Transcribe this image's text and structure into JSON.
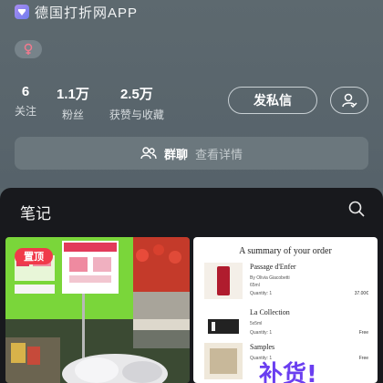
{
  "profile": {
    "ip_location": "德国打折网APP",
    "stats": [
      {
        "value": "6",
        "label": "关注"
      },
      {
        "value": "1.1万",
        "label": "粉丝"
      },
      {
        "value": "2.5万",
        "label": "获赞与收藏"
      }
    ],
    "message_button": "发私信",
    "group": {
      "label": "群聊",
      "detail": "查看详情"
    }
  },
  "notes": {
    "title": "笔记",
    "pinned_badge": "置顶",
    "order_card": {
      "heading": "A summary of your order",
      "items": [
        {
          "name": "Passage d'Enfer",
          "sub1": "By Olivia Giacobetti",
          "sub2": "65ml",
          "sub3": "Quantity: 1",
          "price": "37.00€"
        },
        {
          "name": "La Collection",
          "sub1": "5x5ml",
          "sub2": "",
          "sub3": "Quantity: 1",
          "price": "Free"
        },
        {
          "name": "Samples",
          "sub1": "",
          "sub2": "",
          "sub3": "Quantity: 1",
          "price": "Free"
        }
      ],
      "overlay_text": "补货!"
    }
  },
  "colors": {
    "accent_red": "#f03a4a",
    "panel_dark": "#18191d",
    "header_bg": "#58646a"
  }
}
